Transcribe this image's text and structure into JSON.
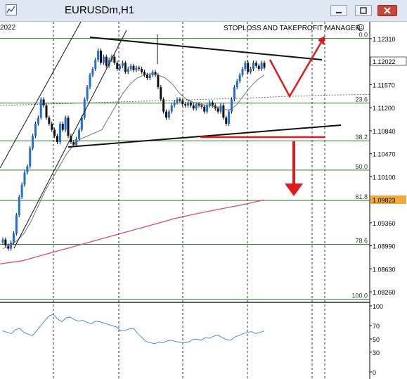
{
  "window": {
    "title": "EURUSDm,H1",
    "date_fragment": "2022",
    "indicator_label": "STOPLOSS AND TAKEPROFIT MANAGER"
  },
  "chart_data": [
    {
      "type": "line",
      "symbol": "EURUSDm",
      "timeframe": "H1",
      "current_price": "1.12022",
      "ma200_price": "1.09823",
      "price_ticks": [
        "1.12310",
        "1.11940",
        "1.11570",
        "1.11200",
        "1.10840",
        "1.10470",
        "1.10100",
        "1.09730",
        "1.09360",
        "1.08990",
        "1.08630",
        "1.08260"
      ],
      "fib_levels": [
        {
          "label": "0.0",
          "price": 1.125
        },
        {
          "label": "23.6",
          "price": 1.1144
        },
        {
          "label": "38.2",
          "price": 1.1082
        },
        {
          "label": "50.0",
          "price": 1.1034
        },
        {
          "label": "61.8",
          "price": 1.0984
        },
        {
          "label": "78.6",
          "price": 1.0912
        },
        {
          "label": "100.0",
          "price": 1.0822
        }
      ],
      "ylim": [
        1.0818,
        1.1275
      ],
      "close_series": [
        1.092,
        1.091,
        1.0905,
        1.0915,
        1.093,
        1.096,
        1.099,
        1.101,
        1.103,
        1.104,
        1.107,
        1.109,
        1.111,
        1.112,
        1.115,
        1.114,
        1.112,
        1.111,
        1.11,
        1.109,
        1.108,
        1.111,
        1.11,
        1.112,
        1.109,
        1.108,
        1.1075,
        1.1085,
        1.11,
        1.112,
        1.115,
        1.117,
        1.119,
        1.12,
        1.1215,
        1.123,
        1.121,
        1.122,
        1.1205,
        1.1215,
        1.122,
        1.121,
        1.12,
        1.1205,
        1.121,
        1.1195,
        1.12,
        1.1205,
        1.1198,
        1.1202,
        1.12,
        1.1195,
        1.119,
        1.1185,
        1.119,
        1.1195,
        1.119,
        1.117,
        1.115,
        1.113,
        1.112,
        1.113,
        1.114,
        1.1145,
        1.115,
        1.1148,
        1.1142,
        1.114,
        1.1145,
        1.114,
        1.1135,
        1.1142,
        1.114,
        1.1138,
        1.113,
        1.114,
        1.1145,
        1.114,
        1.1135,
        1.113,
        1.114,
        1.112,
        1.111,
        1.113,
        1.115,
        1.117,
        1.118,
        1.119,
        1.12,
        1.121,
        1.1195,
        1.12,
        1.121,
        1.1205,
        1.12,
        1.121,
        1.1202
      ],
      "ma_fast": [
        1.0905,
        1.091,
        1.0918,
        1.093,
        1.095,
        1.0975,
        1.1,
        1.102,
        1.104,
        1.106,
        1.1075,
        1.1085,
        1.109,
        1.1095,
        1.11,
        1.112,
        1.114,
        1.116,
        1.1175,
        1.1185,
        1.119,
        1.1192,
        1.119,
        1.1185,
        1.1175,
        1.116,
        1.115,
        1.1145,
        1.1142,
        1.114,
        1.1138,
        1.1135,
        1.1132,
        1.114,
        1.1155,
        1.117,
        1.1182,
        1.119
      ],
      "ma200": [
        1.088,
        1.0885,
        1.0895,
        1.0905,
        1.0915,
        1.0925,
        1.0935,
        1.0945,
        1.0955,
        1.0963,
        1.097,
        1.0977,
        1.0985
      ],
      "ma_slow_dashed": [
        1.114,
        1.1142,
        1.1144,
        1.1146,
        1.1148,
        1.115,
        1.1152,
        1.1155,
        1.1157,
        1.1158
      ],
      "oscillator": {
        "ticks": [
          "100",
          "70",
          "50",
          "30",
          "0"
        ],
        "ylim": [
          0,
          100
        ],
        "values": [
          62,
          60,
          58,
          64,
          66,
          60,
          57,
          55,
          62,
          70,
          78,
          85,
          87,
          80,
          76,
          82,
          83,
          79,
          77,
          78,
          75,
          73,
          77,
          76,
          74,
          72,
          70,
          68,
          62,
          63,
          65,
          66,
          58,
          52,
          46,
          44,
          43,
          45,
          44,
          47,
          48,
          46,
          45,
          44,
          45,
          49,
          50,
          48,
          52,
          51,
          54,
          56,
          52,
          49,
          48,
          53,
          55,
          58,
          60,
          61,
          58,
          60,
          62
        ]
      }
    }
  ]
}
